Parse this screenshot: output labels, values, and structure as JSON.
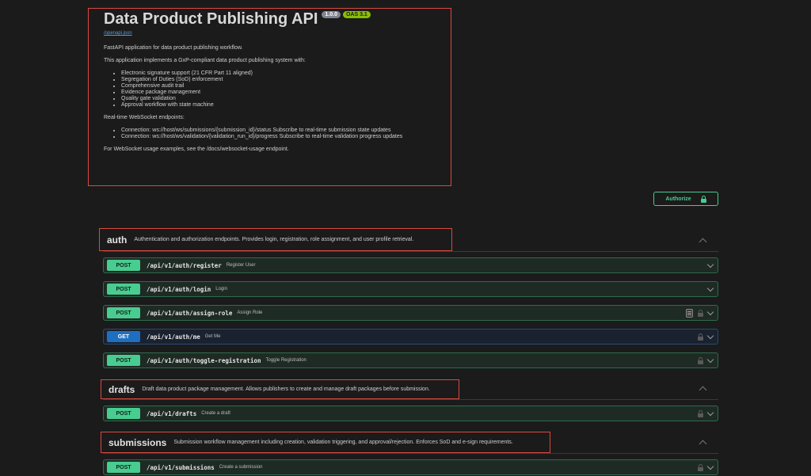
{
  "info": {
    "title": "Data Product Publishing API",
    "version": "1.0.0",
    "oas": "OAS 3.1",
    "spec_link": "/openapi.json",
    "intro": "FastAPI application for data product publishing workflow.",
    "system_line": "This application implements a GxP-compliant data product publishing system with:",
    "features": [
      "Electronic signature support (21 CFR Part 11 aligned)",
      "Segregation of Duties (SoD) enforcement",
      "Comprehensive audit trail",
      "Evidence package management",
      "Quality gate validation",
      "Approval workflow with state machine"
    ],
    "ws_heading": "Real-time WebSocket endpoints:",
    "ws_endpoints": [
      "Connection: ws://host/ws/submissions/{submission_id}/status Subscribe to real-time submission state updates",
      "Connection: ws://host/ws/validation/{validation_run_id}/progress Subscribe to real-time validation progress updates"
    ],
    "ws_footer": "For WebSocket usage examples, see the /docs/websocket-usage endpoint."
  },
  "authorize": {
    "label": "Authorize",
    "icon": "unlock-icon",
    "color": "#49cc90"
  },
  "tags": [
    {
      "name": "auth",
      "description": "Authentication and authorization endpoints. Provides login, registration, role assignment, and user profile retrieval."
    },
    {
      "name": "drafts",
      "description": "Draft data product package management. Allows publishers to create and manage draft packages before submission."
    },
    {
      "name": "submissions",
      "description": "Submission workflow management including creation, validation triggering, and approval/rejection. Enforces SoD and e-sign requirements."
    }
  ],
  "operations": [
    {
      "method": "POST",
      "path": "/api/v1/auth/register",
      "summary": "Register User"
    },
    {
      "method": "POST",
      "path": "/api/v1/auth/login",
      "summary": "Login"
    },
    {
      "method": "POST",
      "path": "/api/v1/auth/assign-role",
      "summary": "Assign Role"
    },
    {
      "method": "GET",
      "path": "/api/v1/auth/me",
      "summary": "Get Me"
    },
    {
      "method": "POST",
      "path": "/api/v1/auth/toggle-registration",
      "summary": "Toggle Registration"
    },
    {
      "method": "POST",
      "path": "/api/v1/drafts",
      "summary": "Create a draft"
    },
    {
      "method": "POST",
      "path": "/api/v1/submissions",
      "summary": "Create a submission"
    }
  ],
  "colors": {
    "post": "#49cc90",
    "get": "#1f6fc1",
    "highlight": "#d9493f"
  }
}
